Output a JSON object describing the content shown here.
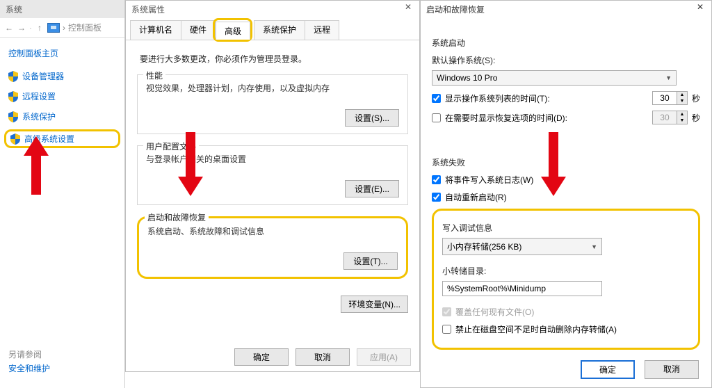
{
  "left": {
    "title": "系统",
    "breadcrumb": "控制面板",
    "cp_home": "控制面板主页",
    "links": {
      "device_mgr": "设备管理器",
      "remote": "远程设置",
      "protection": "系统保护",
      "advanced": "高级系统设置"
    },
    "see_also": "另请参阅",
    "sec_maint": "安全和维护"
  },
  "mid": {
    "title": "系统属性",
    "tabs": {
      "computer_name": "计算机名",
      "hardware": "硬件",
      "advanced": "高级",
      "protection": "系统保护",
      "remote": "远程"
    },
    "hint": "要进行大多数更改，你必须作为管理员登录。",
    "perf": {
      "title": "性能",
      "desc": "视觉效果，处理器计划，内存使用，以及虚拟内存",
      "btn": "设置(S)..."
    },
    "userprof": {
      "title": "用户配置文件",
      "desc": "与登录帐户相关的桌面设置",
      "btn": "设置(E)..."
    },
    "startup": {
      "title": "启动和故障恢复",
      "desc": "系统启动、系统故障和调试信息",
      "btn": "设置(T)..."
    },
    "env_btn": "环境变量(N)...",
    "footer": {
      "ok": "确定",
      "cancel": "取消",
      "apply": "应用(A)"
    }
  },
  "right": {
    "title": "启动和故障恢复",
    "startup_section": "系统启动",
    "default_os_label": "默认操作系统(S):",
    "default_os_value": "Windows 10 Pro",
    "show_os_list": "显示操作系统列表的时间(T):",
    "show_os_time": "30",
    "seconds": "秒",
    "show_recov": "在需要时显示恢复选项的时间(D):",
    "show_recov_time": "30",
    "failure_section": "系统失败",
    "write_event": "将事件写入系统日志(W)",
    "auto_restart": "自动重新启动(R)",
    "debug_label": "写入调试信息",
    "debug_value": "小内存转储(256 KB)",
    "dump_dir_label": "小转储目录:",
    "dump_dir_value": "%SystemRoot%\\Minidump",
    "overwrite": "覆盖任何现有文件(O)",
    "disable_auto_del": "禁止在磁盘空间不足时自动删除内存转储(A)",
    "footer": {
      "ok": "确定",
      "cancel": "取消"
    }
  }
}
